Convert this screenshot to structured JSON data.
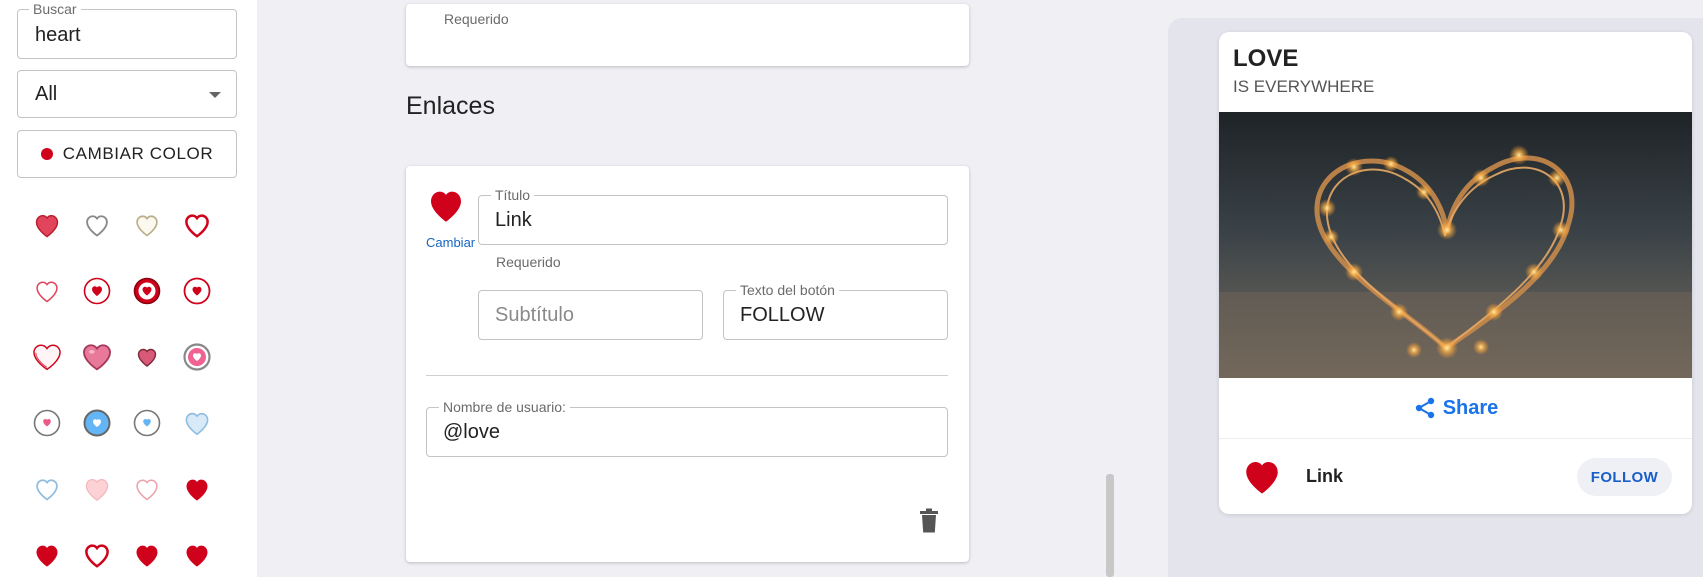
{
  "sidebar": {
    "search": {
      "label": "Buscar",
      "value": "heart"
    },
    "filter": {
      "selected": "All"
    },
    "color_button": {
      "label": "CAMBIAR COLOR",
      "color": "#d0021b"
    },
    "icon_grid": [
      "heart-filled-icon",
      "heart-outline-gray-icon",
      "heart-outline-beige-icon",
      "heart-outline-red-icon",
      "heart-outline-thin-icon",
      "heart-in-circle-icon",
      "heart-in-circle-bold-icon",
      "heart-in-circle-outline-icon",
      "heart-sketch-icon",
      "heart-pink-3d-icon",
      "heart-small-filled-icon",
      "heart-in-ring-icon",
      "heart-circle-pink-icon",
      "heart-circle-blue-icon",
      "heart-circle-light-blue-icon",
      "heart-light-blue-icon",
      "heart-outline-light-blue-icon",
      "heart-light-pink-icon",
      "heart-outline-pale-icon",
      "heart-solid-red-icon",
      "heart-solid-red-2-icon",
      "heart-outline-red-2-icon",
      "heart-solid-red-3-icon",
      "heart-solid-red-4-icon"
    ]
  },
  "editor": {
    "top_card": {
      "helper": "Requerido"
    },
    "section_title": "Enlaces",
    "link": {
      "change_label": "Cambiar",
      "title": {
        "label": "Título",
        "value": "Link",
        "helper": "Requerido"
      },
      "subtitle": {
        "placeholder": "Subtítulo"
      },
      "button_text": {
        "label": "Texto del botón",
        "value": "FOLLOW"
      },
      "username": {
        "label": "Nombre de usuario:",
        "value": "@love"
      }
    }
  },
  "preview": {
    "title": "LOVE",
    "subtitle": "IS EVERYWHERE",
    "share_label": "Share",
    "link_title": "Link",
    "follow_label": "FOLLOW"
  },
  "colors": {
    "accent_red": "#d0021b",
    "link_blue": "#1a73e8"
  }
}
